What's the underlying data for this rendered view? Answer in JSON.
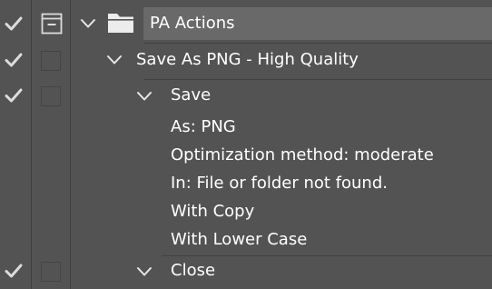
{
  "actions_panel": {
    "set": {
      "name": "PA Actions",
      "enabled": true,
      "expanded": true
    },
    "action": {
      "name": "Save As PNG - High Quality",
      "enabled": true,
      "expanded": true
    },
    "commands": [
      {
        "name": "Save",
        "enabled": true,
        "expanded": true,
        "details": [
          "As: PNG",
          "Optimization method: moderate",
          "In: File or folder not found.",
          "With Copy",
          "With Lower Case"
        ]
      },
      {
        "name": "Close",
        "enabled": true,
        "expanded": true,
        "details": []
      }
    ]
  },
  "icons": {
    "toggle": "checkmark-icon",
    "dialog": "dialog-toggle-icon",
    "expand": "chevron-down-icon",
    "set": "folder-icon"
  },
  "colors": {
    "panel_bg": "#535353",
    "selected_row_bg": "#696969",
    "text": "#ffffff",
    "icon": "#dcdcdc",
    "separator": "#3e3e3e"
  }
}
